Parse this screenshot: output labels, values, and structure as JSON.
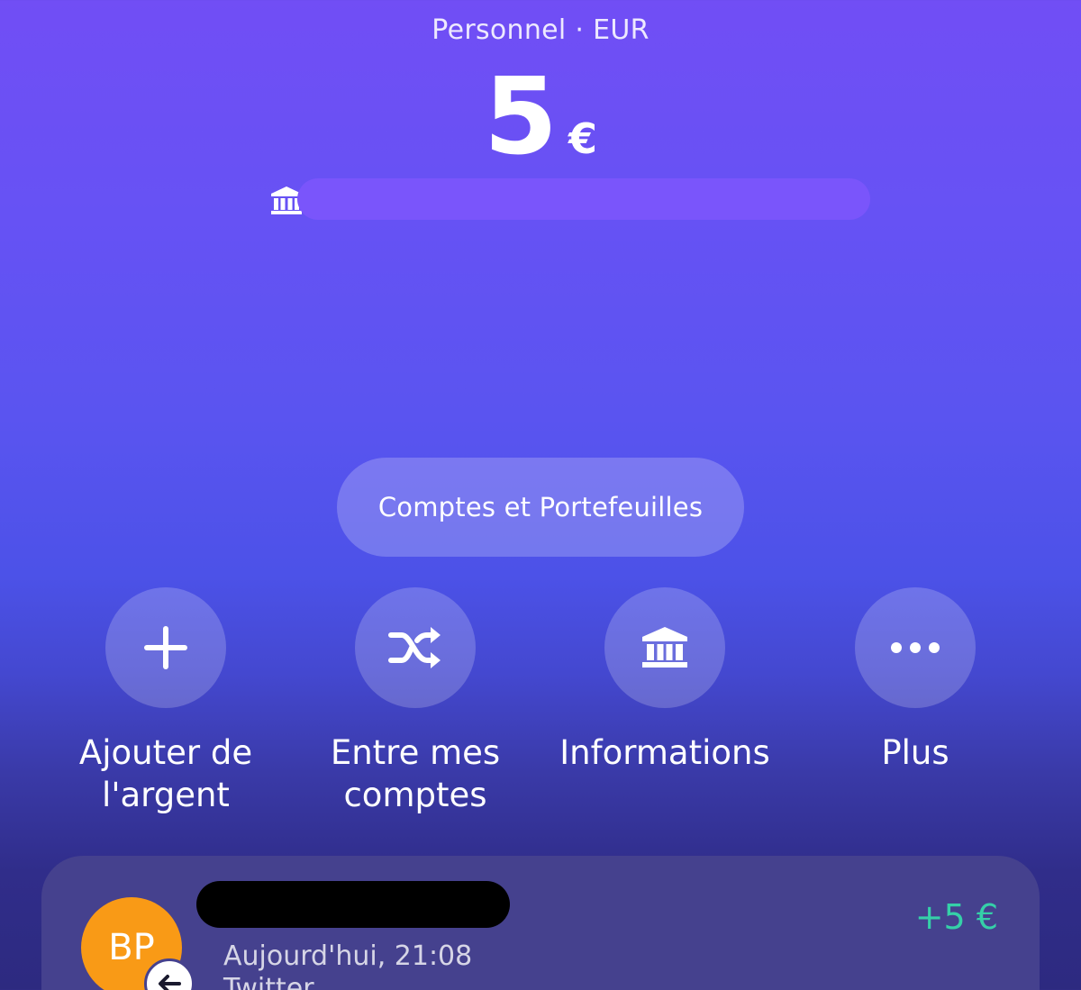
{
  "header": {
    "account_label": "Personnel · EUR"
  },
  "balance": {
    "amount": "5",
    "currency": "€"
  },
  "iban": {
    "icon": "bank-icon"
  },
  "accounts_button": {
    "label": "Comptes et Portefeuilles"
  },
  "actions": [
    {
      "label": "Ajouter de l'argent",
      "icon": "plus-icon"
    },
    {
      "label": "Entre mes comptes",
      "icon": "shuffle-icon"
    },
    {
      "label": "Informations",
      "icon": "bank-icon"
    },
    {
      "label": "Plus",
      "icon": "more-icon"
    }
  ],
  "transaction": {
    "avatar_initials": "BP",
    "date": "Aujourd'hui, 21:08",
    "note": "Twitter",
    "amount": "+5 €",
    "amount_color": "#35d0a8",
    "avatar_color": "#f99a16"
  },
  "colors": {
    "background_top": "#714ef5",
    "background_bottom": "#2d2a80"
  }
}
